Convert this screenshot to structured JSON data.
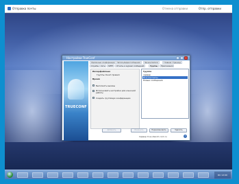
{
  "topbar": {
    "app_title": "Отправка почты",
    "mid_label": "Отмена отправки",
    "right_label": "Отпр. отправки"
  },
  "dialog": {
    "title": "Настройки TrueConf",
    "brand_logo": "TRUECONF",
    "tabs": [
      "Удаленные конференции",
      "Запись/видеосообщения",
      "Звонки/записи",
      "Главная страница",
      "Службы",
      "Сеть",
      "SMTP",
      "Отчеты и журнал сообщений",
      "Группы",
      "Приложения"
    ],
    "left_panel": {
      "heading": "Интерфейсные",
      "subline": "Группы Ожит.правил",
      "section": "Время",
      "checks": [
        {
          "label": "Выполнять вызовы",
          "checked": true
        },
        {
          "label": "Использовать настройки для конечной работы",
          "checked": true
        },
        {
          "label": "Создать групповую конференцию",
          "checked": true
        }
      ]
    },
    "right_panel": {
      "heading": "Группа",
      "items": [
        {
          "label": "сервер",
          "selected": false
        },
        {
          "label": "Все контакты",
          "selected": true
        },
        {
          "label": "Новые сообщения",
          "selected": false
        }
      ]
    },
    "buttons": {
      "add": "Добавить",
      "edit": "Изменить",
      "rename": "Переименовать",
      "delete": "Удалить"
    },
    "footer_text": "Сервер: true.xbench.cc/m.ru"
  },
  "taskbar": {
    "tray_text": "RU 12:00"
  }
}
